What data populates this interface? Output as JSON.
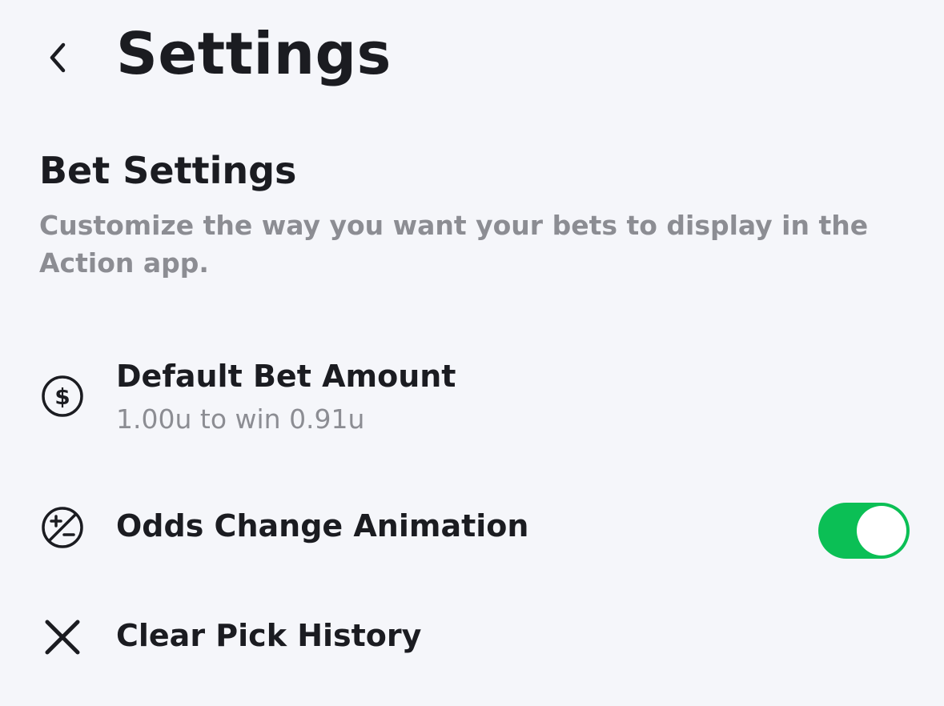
{
  "header": {
    "title": "Settings",
    "back_icon": "chevron-left-icon"
  },
  "bet_settings": {
    "title": "Bet Settings",
    "description": "Customize the way you want your bets to display in the Action app."
  },
  "rows": [
    {
      "icon": "dollar-circle-icon",
      "label": "Default Bet Amount",
      "sublabel": "1.00u to win 0.91u"
    },
    {
      "icon": "plus-minus-circle-icon",
      "label": "Odds Change Animation",
      "toggle_on": true
    },
    {
      "icon": "close-icon",
      "label": "Clear Pick History"
    }
  ],
  "colors": {
    "background": "#f5f6fa",
    "toggle_on": "#0bbf55",
    "secondary_text": "#8c8d93",
    "primary_text": "#1b1c21"
  }
}
